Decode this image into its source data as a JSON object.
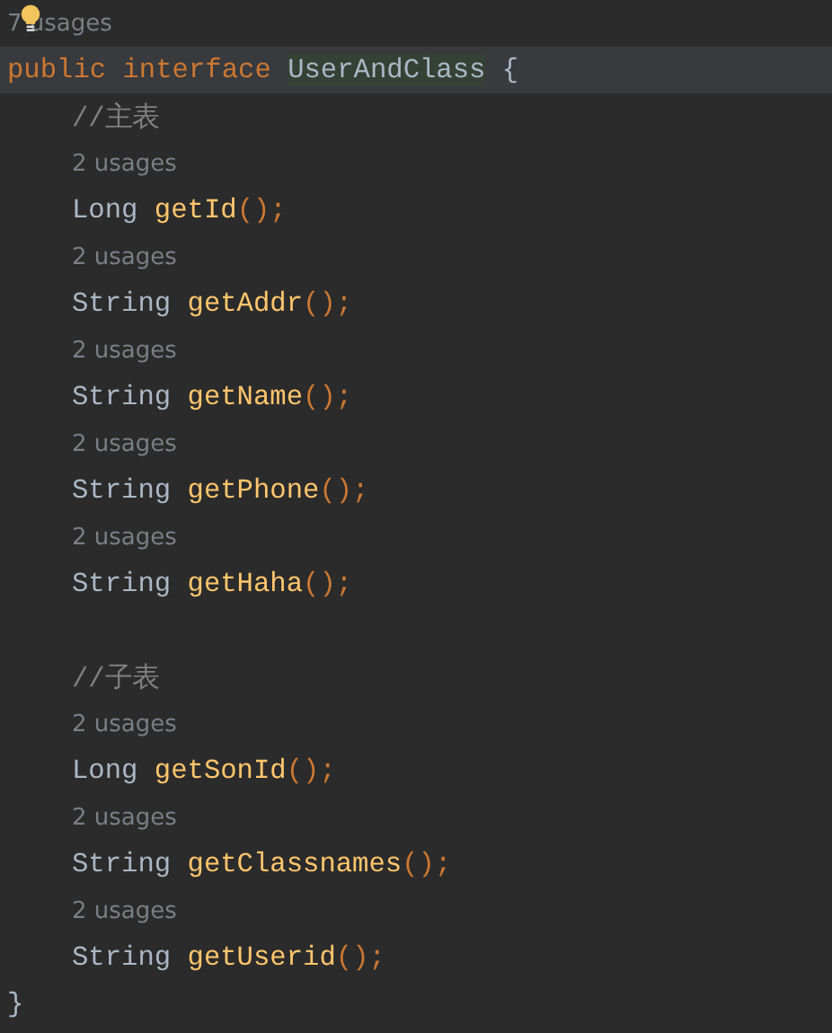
{
  "lines": [
    {
      "kind": "usages",
      "text": "7 usages",
      "bulb": true,
      "indent": false
    },
    {
      "kind": "header",
      "keywords": "public interface",
      "name": "UserAndClass",
      "brace": "{",
      "current": true
    },
    {
      "kind": "comment",
      "text": "//主表"
    },
    {
      "kind": "usages",
      "text": "2 usages",
      "bulb": false,
      "indent": true
    },
    {
      "kind": "decl",
      "type": "Long",
      "method": "getId",
      "punct": "();"
    },
    {
      "kind": "usages",
      "text": "2 usages",
      "bulb": false,
      "indent": true
    },
    {
      "kind": "decl",
      "type": "String",
      "method": "getAddr",
      "punct": "();"
    },
    {
      "kind": "usages",
      "text": "2 usages",
      "bulb": false,
      "indent": true
    },
    {
      "kind": "decl",
      "type": "String",
      "method": "getName",
      "punct": "();"
    },
    {
      "kind": "usages",
      "text": "2 usages",
      "bulb": false,
      "indent": true
    },
    {
      "kind": "decl",
      "type": "String",
      "method": "getPhone",
      "punct": "();"
    },
    {
      "kind": "usages",
      "text": "2 usages",
      "bulb": false,
      "indent": true
    },
    {
      "kind": "decl",
      "type": "String",
      "method": "getHaha",
      "punct": "();"
    },
    {
      "kind": "blank"
    },
    {
      "kind": "comment",
      "text": "//子表"
    },
    {
      "kind": "usages",
      "text": "2 usages",
      "bulb": false,
      "indent": true
    },
    {
      "kind": "decl",
      "type": "Long",
      "method": "getSonId",
      "punct": "();"
    },
    {
      "kind": "usages",
      "text": "2 usages",
      "bulb": false,
      "indent": true
    },
    {
      "kind": "decl",
      "type": "String",
      "method": "getClassnames",
      "punct": "();"
    },
    {
      "kind": "usages",
      "text": "2 usages",
      "bulb": false,
      "indent": true
    },
    {
      "kind": "decl",
      "type": "String",
      "method": "getUserid",
      "punct": "();"
    },
    {
      "kind": "close",
      "brace": "}"
    }
  ]
}
